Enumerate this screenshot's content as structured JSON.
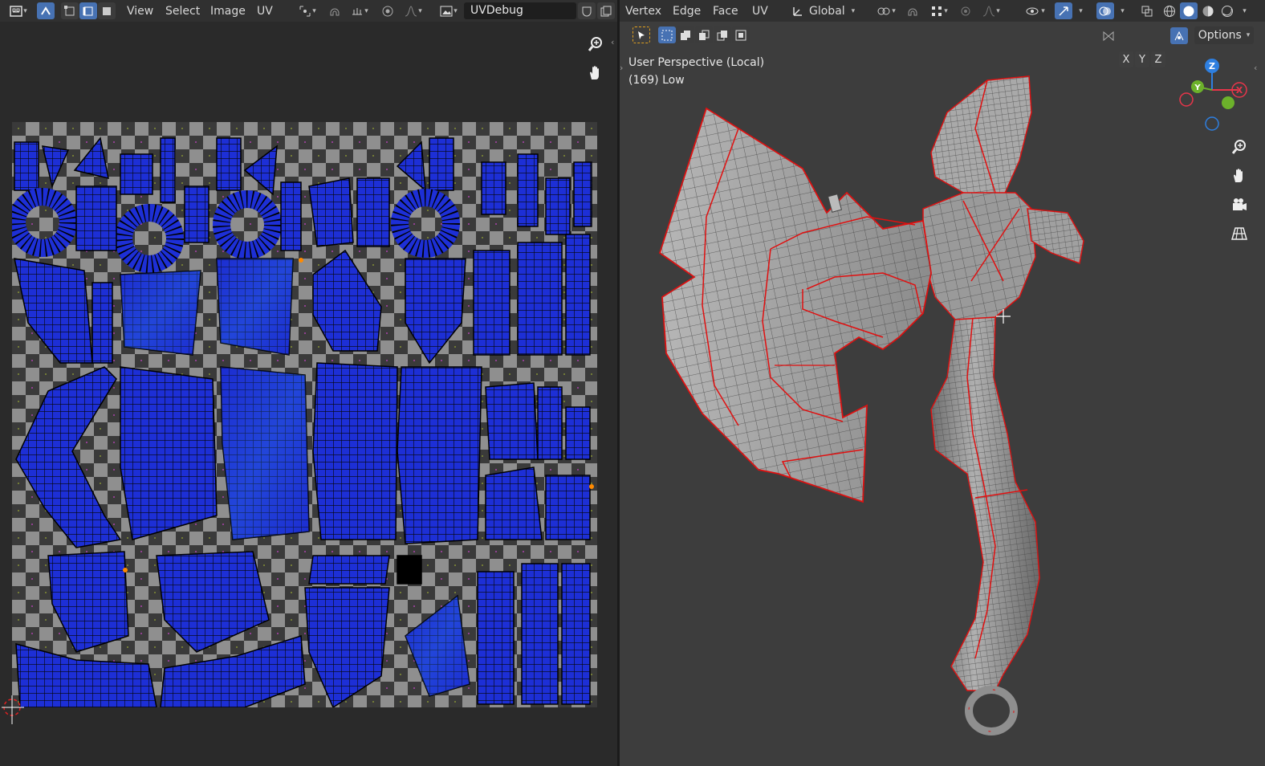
{
  "uv_editor": {
    "menu": {
      "view": "View",
      "select": "Select",
      "image": "Image",
      "uv": "UV"
    },
    "image_name": "UVDebug",
    "icons": [
      "editor-type-icon",
      "sync-selection-icon",
      "vertex-select-icon",
      "edge-select-icon",
      "face-select-icon",
      "pivot-icon",
      "snap-icon",
      "snap-target-icon",
      "proportional-edit-icon",
      "falloff-icon",
      "image-browse-icon",
      "fake-user-icon",
      "new-image-icon",
      "zoom-icon",
      "hand-pan-icon",
      "cursor-2d-icon"
    ]
  },
  "viewport": {
    "menu": {
      "vertex": "Vertex",
      "edge": "Edge",
      "face": "Face",
      "uv": "UV"
    },
    "transform_orientation": "Global",
    "info_line1": "User Perspective (Local)",
    "info_line2": "(169) Low",
    "axis_labels": {
      "x": "X",
      "y": "Y",
      "z": "Z"
    },
    "options_label": "Options",
    "gizmo": {
      "x": "X",
      "y": "Y",
      "z": "Z"
    },
    "colors": {
      "seam": "#e01010",
      "mesh": "#8a8a8a",
      "gizmo_x": "#e8354a",
      "gizmo_y": "#6cb12b",
      "gizmo_z": "#2e7fe0"
    }
  },
  "colors": {
    "uv_island": "#1a2fd8",
    "selection": "#4772b3"
  }
}
